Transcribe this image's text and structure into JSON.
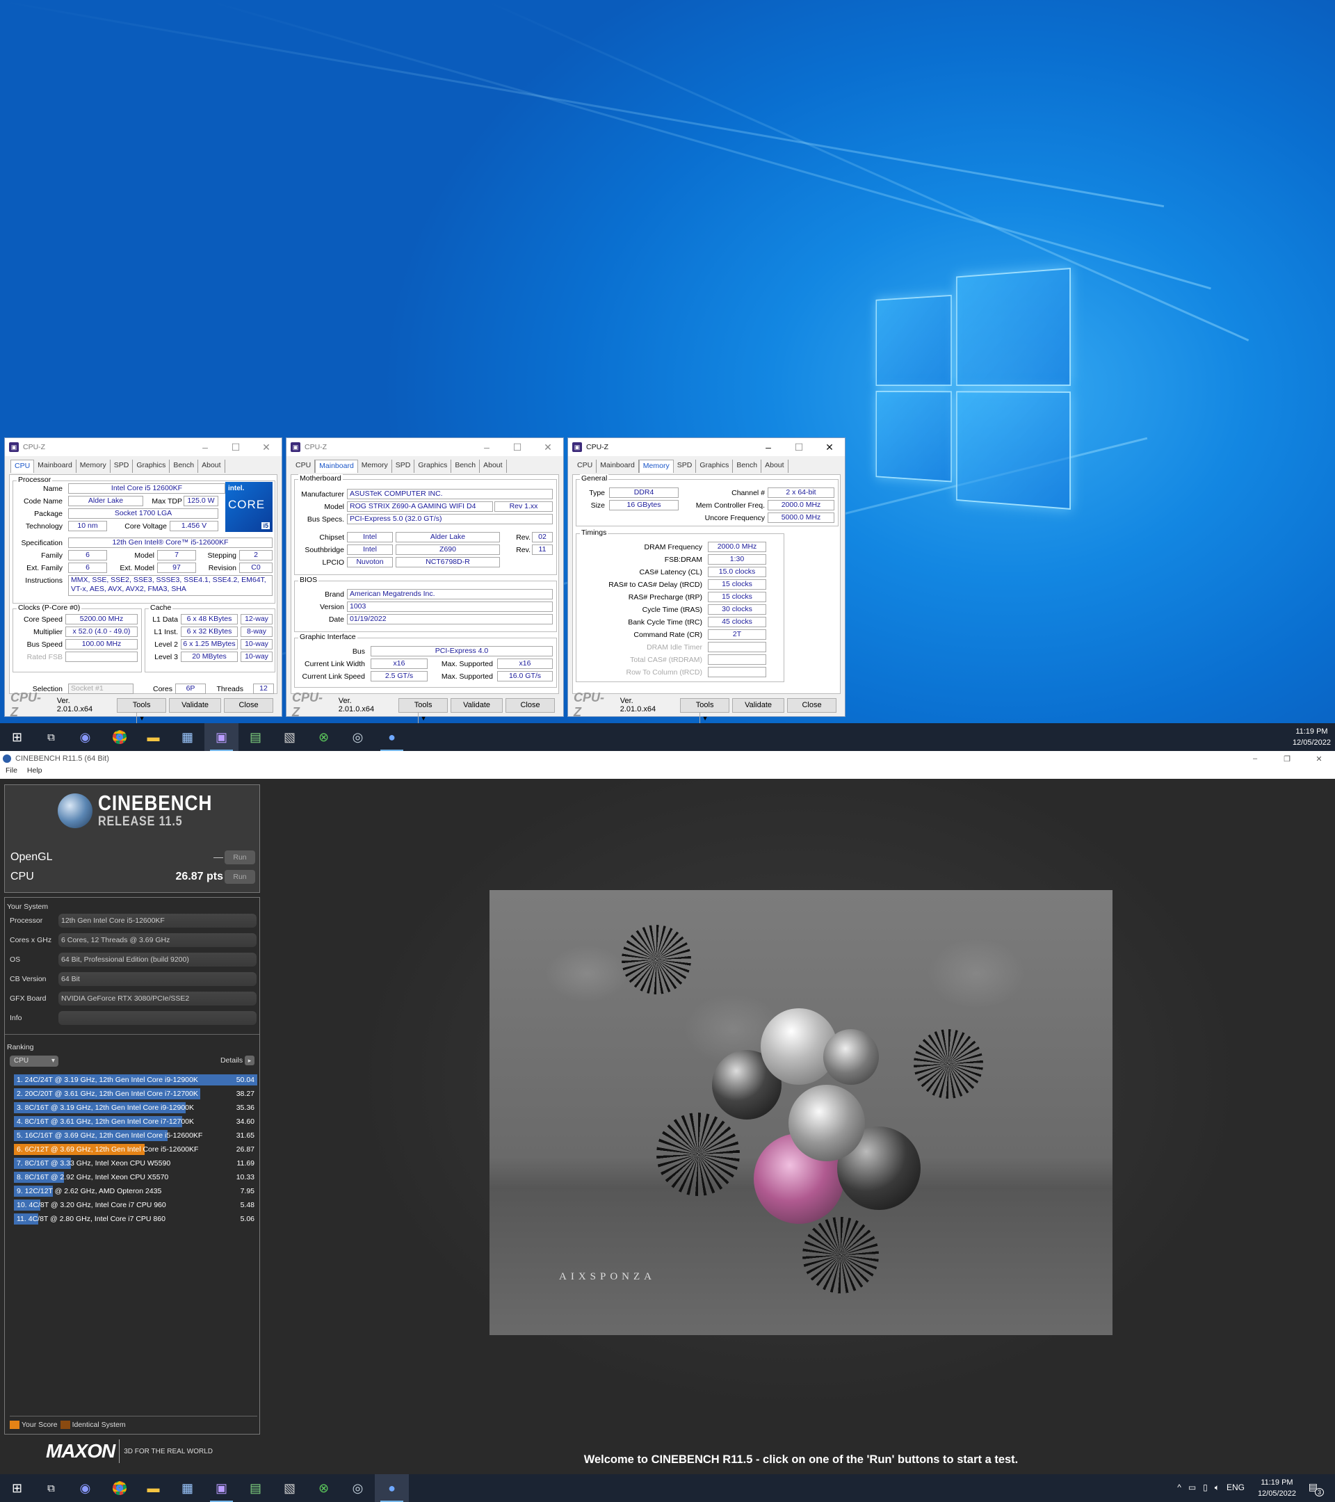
{
  "cpuz_common": {
    "title": "CPU-Z",
    "version": "Ver. 2.01.0.x64",
    "tools": "Tools",
    "validate": "Validate",
    "close": "Close",
    "logo": "CPU-Z"
  },
  "tabs": [
    "CPU",
    "Mainboard",
    "Memory",
    "SPD",
    "Graphics",
    "Bench",
    "About"
  ],
  "cpu": {
    "group_processor": "Processor",
    "name_l": "Name",
    "name": "Intel Core i5 12600KF",
    "code_l": "Code Name",
    "code": "Alder Lake",
    "tdp_l": "Max TDP",
    "tdp": "125.0 W",
    "pkg_l": "Package",
    "pkg": "Socket 1700 LGA",
    "tech_l": "Technology",
    "tech": "10 nm",
    "cv_l": "Core Voltage",
    "cv": "1.456 V",
    "spec_l": "Specification",
    "spec": "12th Gen Intel® Core™ i5-12600KF",
    "fam_l": "Family",
    "fam": "6",
    "model_l": "Model",
    "model": "7",
    "step_l": "Stepping",
    "step": "2",
    "efam_l": "Ext. Family",
    "efam": "6",
    "emodel_l": "Ext. Model",
    "emodel": "97",
    "rev_l": "Revision",
    "rev": "C0",
    "instr_l": "Instructions",
    "instr": "MMX, SSE, SSE2, SSE3, SSSE3, SSE4.1, SSE4.2, EM64T, VT-x, AES, AVX, AVX2, FMA3, SHA",
    "badge_intel": "intel.",
    "badge_core": "CORE",
    "badge_i": "i5",
    "group_clocks": "Clocks (P-Core #0)",
    "cs_l": "Core Speed",
    "cs": "5200.00 MHz",
    "mul_l": "Multiplier",
    "mul": "x 52.0 (4.0 - 49.0)",
    "bus_l": "Bus Speed",
    "bus": "100.00 MHz",
    "fsb_l": "Rated FSB",
    "fsb": "",
    "group_cache": "Cache",
    "l1d_l": "L1 Data",
    "l1d": "6 x 48 KBytes",
    "l1d_w": "12-way",
    "l1i_l": "L1 Inst.",
    "l1i": "6 x 32 KBytes",
    "l1i_w": "8-way",
    "l2_l": "Level 2",
    "l2": "6 x 1.25 MBytes",
    "l2_w": "10-way",
    "l3_l": "Level 3",
    "l3": "20 MBytes",
    "l3_w": "10-way",
    "sel_l": "Selection",
    "sel": "Socket #1",
    "cores_l": "Cores",
    "cores": "6P",
    "thr_l": "Threads",
    "thr": "12"
  },
  "mb": {
    "group_mb": "Motherboard",
    "man_l": "Manufacturer",
    "man": "ASUSTeK COMPUTER INC.",
    "model_l": "Model",
    "model": "ROG STRIX Z690-A GAMING WIFI D4",
    "model_rev": "Rev 1.xx",
    "bus_l": "Bus Specs.",
    "bus": "PCI-Express 5.0 (32.0 GT/s)",
    "chip_l": "Chipset",
    "chip1": "Intel",
    "chip2": "Alder Lake",
    "chip_rev_l": "Rev.",
    "chip_rev": "02",
    "sb_l": "Southbridge",
    "sb1": "Intel",
    "sb2": "Z690",
    "sb_rev_l": "Rev.",
    "sb_rev": "11",
    "lpc_l": "LPCIO",
    "lpc1": "Nuvoton",
    "lpc2": "NCT6798D-R",
    "group_bios": "BIOS",
    "brand_l": "Brand",
    "brand": "American Megatrends Inc.",
    "ver_l": "Version",
    "ver": "1003",
    "date_l": "Date",
    "date": "01/19/2022",
    "group_gi": "Graphic Interface",
    "gbus_l": "Bus",
    "gbus": "PCI-Express 4.0",
    "clw_l": "Current Link Width",
    "clw": "x16",
    "msw_l": "Max. Supported",
    "msw": "x16",
    "cls_l": "Current Link Speed",
    "cls": "2.5 GT/s",
    "mss_l": "Max. Supported",
    "mss": "16.0 GT/s"
  },
  "mem": {
    "group_gen": "General",
    "type_l": "Type",
    "type": "DDR4",
    "ch_l": "Channel #",
    "ch": "2 x 64-bit",
    "size_l": "Size",
    "size": "16 GBytes",
    "mcf_l": "Mem Controller Freq.",
    "mcf": "2000.0 MHz",
    "unc_l": "Uncore Frequency",
    "unc": "5000.0 MHz",
    "group_tim": "Timings",
    "rows": [
      {
        "l": "DRAM Frequency",
        "v": "2000.0 MHz",
        "dim": false
      },
      {
        "l": "FSB:DRAM",
        "v": "1:30",
        "dim": false
      },
      {
        "l": "CAS# Latency (CL)",
        "v": "15.0 clocks",
        "dim": false
      },
      {
        "l": "RAS# to CAS# Delay (tRCD)",
        "v": "15 clocks",
        "dim": false
      },
      {
        "l": "RAS# Precharge (tRP)",
        "v": "15 clocks",
        "dim": false
      },
      {
        "l": "Cycle Time (tRAS)",
        "v": "30 clocks",
        "dim": false
      },
      {
        "l": "Bank Cycle Time (tRC)",
        "v": "45 clocks",
        "dim": false
      },
      {
        "l": "Command Rate (CR)",
        "v": "2T",
        "dim": false
      },
      {
        "l": "DRAM Idle Timer",
        "v": "",
        "dim": true
      },
      {
        "l": "Total CAS# (tRDRAM)",
        "v": "",
        "dim": true
      },
      {
        "l": "Row To Column (tRCD)",
        "v": "",
        "dim": true
      }
    ]
  },
  "taskbar": {
    "time": "11:19 PM",
    "date": "12/05/2022",
    "lang": "ENG",
    "notif": "3"
  },
  "cinebench": {
    "title": "CINEBENCH R11.5 (64 Bit)",
    "menu": [
      "File",
      "Help"
    ],
    "logo_1": "CINEBENCH",
    "logo_2": "RELEASE 11.5",
    "opengl_l": "OpenGL",
    "opengl_v": "—",
    "cpu_l": "CPU",
    "cpu_v": "26.87 pts",
    "run": "Run",
    "sys_title": "Your System",
    "sys": [
      {
        "k": "Processor",
        "v": "12th Gen Intel Core i5-12600KF"
      },
      {
        "k": "Cores x GHz",
        "v": "6 Cores, 12 Threads @ 3.69 GHz"
      },
      {
        "k": "OS",
        "v": "64 Bit, Professional Edition (build 9200)"
      },
      {
        "k": "CB Version",
        "v": "64 Bit"
      },
      {
        "k": "GFX Board",
        "v": "NVIDIA GeForce RTX 3080/PCIe/SSE2"
      },
      {
        "k": "Info",
        "v": ""
      }
    ],
    "rank_title": "Ranking",
    "rank_sel": "CPU",
    "details": "Details",
    "ranking": [
      {
        "t": "1. 24C/24T @ 3.19 GHz, 12th Gen Intel Core i9-12900K",
        "s": 50.04,
        "me": false
      },
      {
        "t": "2. 20C/20T @ 3.61 GHz, 12th Gen Intel Core i7-12700K",
        "s": 38.27,
        "me": false
      },
      {
        "t": "3. 8C/16T @ 3.19 GHz, 12th Gen Intel Core i9-12900K",
        "s": 35.36,
        "me": false
      },
      {
        "t": "4. 8C/16T @ 3.61 GHz, 12th Gen Intel Core i7-12700K",
        "s": 34.6,
        "me": false
      },
      {
        "t": "5. 16C/16T @ 3.69 GHz, 12th Gen Intel Core i5-12600KF",
        "s": 31.65,
        "me": false
      },
      {
        "t": "6. 6C/12T @ 3.69 GHz, 12th Gen Intel Core i5-12600KF",
        "s": 26.87,
        "me": true
      },
      {
        "t": "7. 8C/16T @ 3.33 GHz, Intel Xeon CPU W5590",
        "s": 11.69,
        "me": false
      },
      {
        "t": "8. 8C/16T @ 2.92 GHz, Intel Xeon CPU X5570",
        "s": 10.33,
        "me": false
      },
      {
        "t": "9. 12C/12T @ 2.62 GHz, AMD Opteron 2435",
        "s": 7.95,
        "me": false
      },
      {
        "t": "10. 4C/8T @ 3.20 GHz, Intel Core i7 CPU 960",
        "s": 5.48,
        "me": false
      },
      {
        "t": "11. 4C/8T @ 2.80 GHz, Intel Core i7 CPU 860",
        "s": 5.06,
        "me": false
      }
    ],
    "legend_score": "Your Score",
    "legend_ident": "Identical System",
    "maxon": "MAXON",
    "maxon_tag": "3D FOR THE REAL WORLD",
    "render_logo": "AIXSPONZA",
    "welcome": "Welcome to CINEBENCH R11.5 - click on one of the 'Run' buttons to start a test."
  },
  "colors": {
    "score": "#e58316",
    "rank_bar": "#3d6fb5",
    "cpuz_value": "#1a1a9a"
  }
}
